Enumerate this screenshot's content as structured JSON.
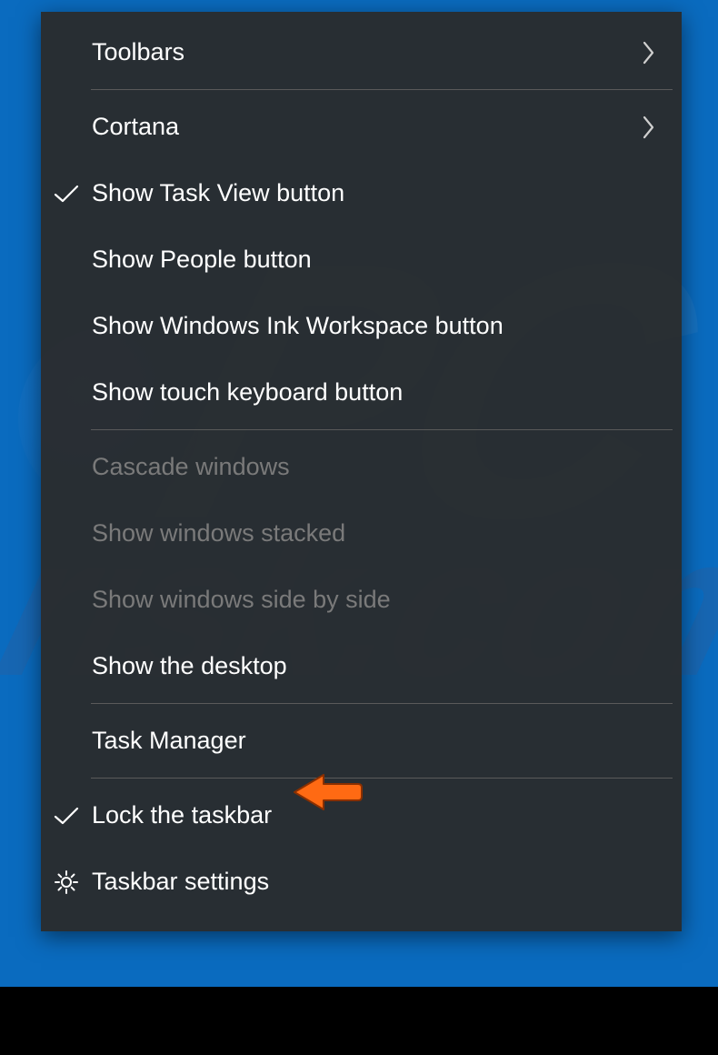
{
  "menu": {
    "items": [
      {
        "label": "Toolbars",
        "icon": null,
        "submenu": true,
        "disabled": false
      },
      {
        "label": "Cortana",
        "icon": null,
        "submenu": true,
        "disabled": false
      },
      {
        "label": "Show Task View button",
        "icon": "checkmark",
        "submenu": false,
        "disabled": false
      },
      {
        "label": "Show People button",
        "icon": null,
        "submenu": false,
        "disabled": false
      },
      {
        "label": "Show Windows Ink Workspace button",
        "icon": null,
        "submenu": false,
        "disabled": false
      },
      {
        "label": "Show touch keyboard button",
        "icon": null,
        "submenu": false,
        "disabled": false
      },
      {
        "label": "Cascade windows",
        "icon": null,
        "submenu": false,
        "disabled": true
      },
      {
        "label": "Show windows stacked",
        "icon": null,
        "submenu": false,
        "disabled": true
      },
      {
        "label": "Show windows side by side",
        "icon": null,
        "submenu": false,
        "disabled": true
      },
      {
        "label": "Show the desktop",
        "icon": null,
        "submenu": false,
        "disabled": false
      },
      {
        "label": "Task Manager",
        "icon": null,
        "submenu": false,
        "disabled": false
      },
      {
        "label": "Lock the taskbar",
        "icon": "checkmark",
        "submenu": false,
        "disabled": false
      },
      {
        "label": "Taskbar settings",
        "icon": "gear",
        "submenu": false,
        "disabled": false
      }
    ]
  },
  "callout": {
    "target_label": "Task Manager",
    "color": "#ff6a13"
  }
}
